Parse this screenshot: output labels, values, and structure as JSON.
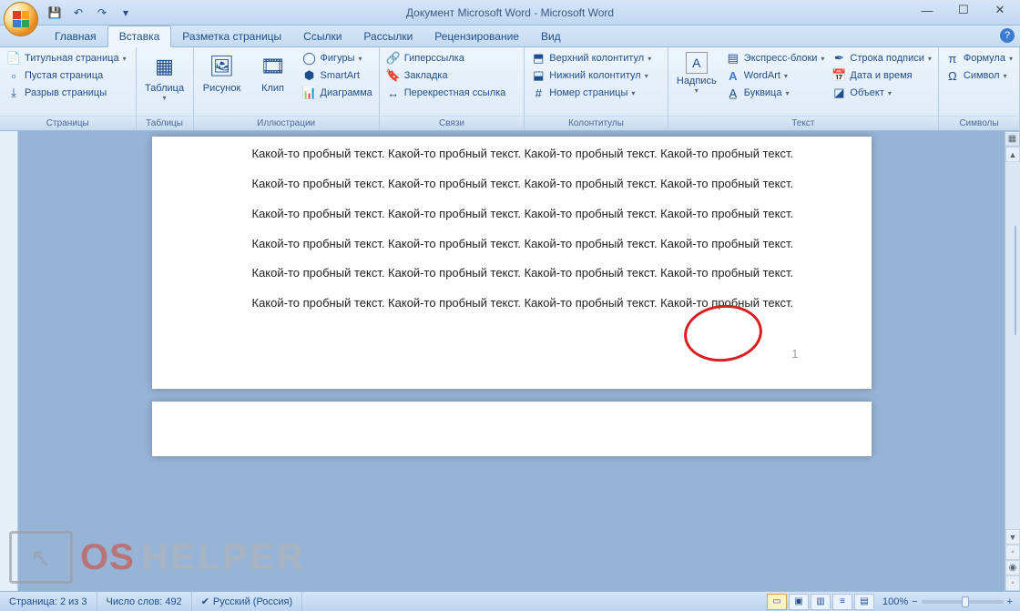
{
  "title": "Документ Microsoft Word - Microsoft Word",
  "tabs": [
    "Главная",
    "Вставка",
    "Разметка страницы",
    "Ссылки",
    "Рассылки",
    "Рецензирование",
    "Вид"
  ],
  "activeTab": 1,
  "ribbon": {
    "pages": {
      "label": "Страницы",
      "titlePage": "Титульная страница",
      "blankPage": "Пустая страница",
      "pageBreak": "Разрыв страницы"
    },
    "tables": {
      "label": "Таблицы",
      "table": "Таблица"
    },
    "illustrations": {
      "label": "Иллюстрации",
      "picture": "Рисунок",
      "clip": "Клип",
      "shapes": "Фигуры",
      "smartart": "SmartArt",
      "chart": "Диаграмма"
    },
    "links": {
      "label": "Связи",
      "hyperlink": "Гиперссылка",
      "bookmark": "Закладка",
      "crossref": "Перекрестная ссылка"
    },
    "headerfooter": {
      "label": "Колонтитулы",
      "header": "Верхний колонтитул",
      "footer": "Нижний колонтитул",
      "pagenum": "Номер страницы"
    },
    "text": {
      "label": "Текст",
      "textbox": "Надпись",
      "quickparts": "Экспресс-блоки",
      "wordart": "WordArt",
      "dropcap": "Буквица",
      "sigline": "Строка подписи",
      "datetime": "Дата и время",
      "object": "Объект"
    },
    "symbols": {
      "label": "Символы",
      "equation": "Формула",
      "symbol": "Символ"
    }
  },
  "document": {
    "paragraph": "Какой-то пробный текст. Какой-то пробный текст. Какой-то пробный текст. Какой-то пробный текст.",
    "pageNumber": "1"
  },
  "status": {
    "page": "Страница: 2 из 3",
    "words": "Число слов: 492",
    "lang": "Русский (Россия)",
    "zoom": "100%"
  },
  "watermark": {
    "a": "OS",
    "b": "HELPER"
  }
}
